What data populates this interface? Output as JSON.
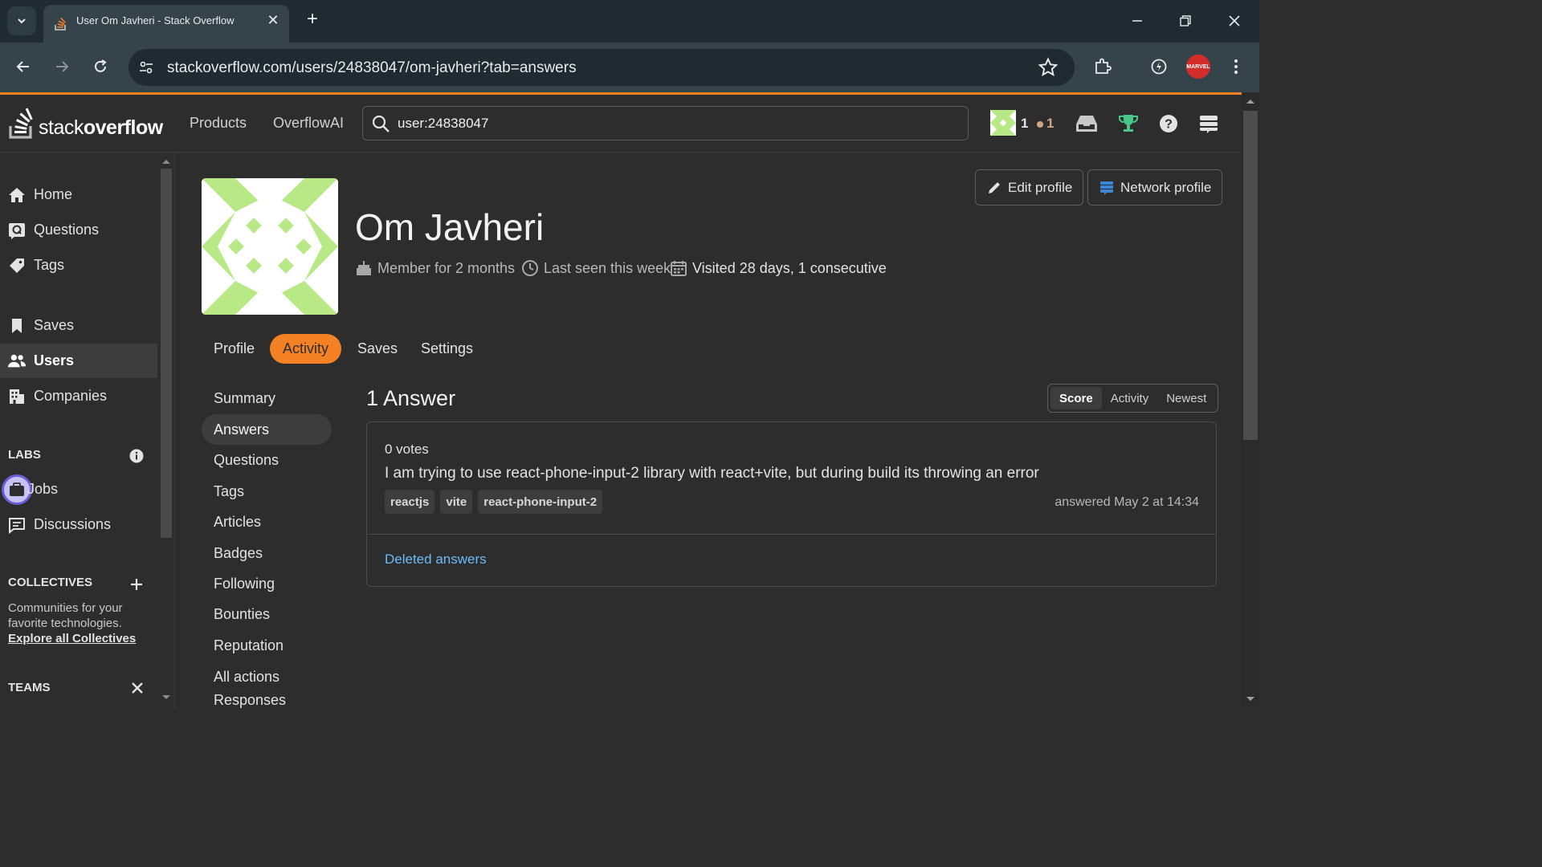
{
  "browser": {
    "tab_title": "User Om Javheri - Stack Overflow",
    "url": "stackoverflow.com/users/24838047/om-javheri?tab=answers",
    "profile_label": "MARVEL"
  },
  "header": {
    "logo_word_light": "stack",
    "logo_word_bold": "overflow",
    "nav": [
      "Products",
      "OverflowAI"
    ],
    "search_value": "user:24838047",
    "reputation": "1",
    "bronze_badges": "1"
  },
  "sidebar": {
    "items": [
      {
        "label": "Home",
        "icon": "home-icon"
      },
      {
        "label": "Questions",
        "icon": "questions-icon"
      },
      {
        "label": "Tags",
        "icon": "tag-icon"
      },
      {
        "label": "Saves",
        "icon": "bookmark-icon"
      },
      {
        "label": "Users",
        "icon": "users-icon",
        "active": true
      },
      {
        "label": "Companies",
        "icon": "companies-icon"
      },
      {
        "label": "Jobs",
        "icon": "briefcase-icon"
      },
      {
        "label": "Discussions",
        "icon": "discussions-icon"
      }
    ],
    "labs_heading": "LABS",
    "collectives_heading": "COLLECTIVES",
    "collectives_text_1": "Communities for your",
    "collectives_text_2": "favorite technologies.",
    "collectives_link": "Explore all Collectives",
    "teams_heading": "TEAMS"
  },
  "profile": {
    "name": "Om Javheri",
    "member_for": "Member for 2 months",
    "last_seen": "Last seen this week",
    "visited": "Visited 28 days, 1 consecutive",
    "edit_profile": "Edit profile",
    "network_profile": "Network profile",
    "tabs": [
      "Profile",
      "Activity",
      "Saves",
      "Settings"
    ],
    "active_tab": "Activity"
  },
  "activity_nav": [
    "Summary",
    "Answers",
    "Questions",
    "Tags",
    "Articles",
    "Badges",
    "Following",
    "Bounties",
    "Reputation",
    "All actions",
    "Responses"
  ],
  "answers": {
    "title": "1 Answer",
    "sort_options": [
      "Score",
      "Activity",
      "Newest"
    ],
    "sort_active": "Score",
    "items": [
      {
        "votes": "0 votes",
        "title": "I am trying to use react-phone-input-2 library with react+vite, but during build its throwing an error",
        "tags": [
          "reactjs",
          "vite",
          "react-phone-input-2"
        ],
        "answered": "answered May 2 at 14:34"
      }
    ],
    "deleted_link": "Deleted answers"
  },
  "colors": {
    "accent": "#f48225",
    "link": "#6cbbf7",
    "avatar_green": "#b8e986"
  }
}
